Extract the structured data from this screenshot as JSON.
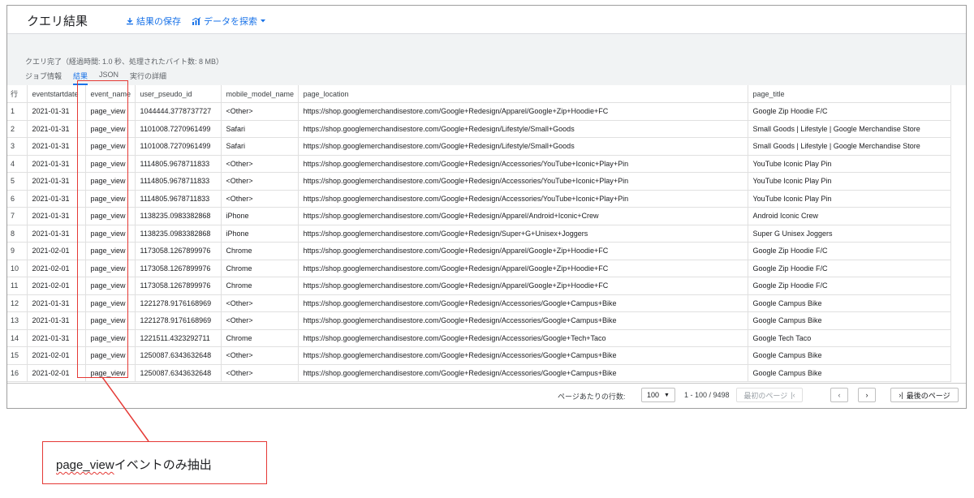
{
  "header": {
    "title": "クエリ結果",
    "save_label": "結果の保存",
    "explore_label": "データを探索"
  },
  "status_text": "クエリ完了（経過時間: 1.0 秒、処理されたバイト数: 8 MB）",
  "tabs": [
    {
      "label": "ジョブ情報",
      "active": false
    },
    {
      "label": "結果",
      "active": true
    },
    {
      "label": "JSON",
      "active": false
    },
    {
      "label": "実行の詳細",
      "active": false
    }
  ],
  "table": {
    "columns": [
      "行",
      "eventstartdate",
      "event_name",
      "user_pseudo_id",
      "mobile_model_name",
      "page_location",
      "page_title"
    ],
    "rows": [
      [
        "1",
        "2021-01-31",
        "page_view",
        "1044444.3778737727",
        "<Other>",
        "https://shop.googlemerchandisestore.com/Google+Redesign/Apparel/Google+Zip+Hoodie+FC",
        "Google Zip Hoodie F/C"
      ],
      [
        "2",
        "2021-01-31",
        "page_view",
        "1101008.7270961499",
        "Safari",
        "https://shop.googlemerchandisestore.com/Google+Redesign/Lifestyle/Small+Goods",
        "Small Goods | Lifestyle | Google Merchandise Store"
      ],
      [
        "3",
        "2021-01-31",
        "page_view",
        "1101008.7270961499",
        "Safari",
        "https://shop.googlemerchandisestore.com/Google+Redesign/Lifestyle/Small+Goods",
        "Small Goods | Lifestyle | Google Merchandise Store"
      ],
      [
        "4",
        "2021-01-31",
        "page_view",
        "1114805.9678711833",
        "<Other>",
        "https://shop.googlemerchandisestore.com/Google+Redesign/Accessories/YouTube+Iconic+Play+Pin",
        "YouTube Iconic Play Pin"
      ],
      [
        "5",
        "2021-01-31",
        "page_view",
        "1114805.9678711833",
        "<Other>",
        "https://shop.googlemerchandisestore.com/Google+Redesign/Accessories/YouTube+Iconic+Play+Pin",
        "YouTube Iconic Play Pin"
      ],
      [
        "6",
        "2021-01-31",
        "page_view",
        "1114805.9678711833",
        "<Other>",
        "https://shop.googlemerchandisestore.com/Google+Redesign/Accessories/YouTube+Iconic+Play+Pin",
        "YouTube Iconic Play Pin"
      ],
      [
        "7",
        "2021-01-31",
        "page_view",
        "1138235.0983382868",
        "iPhone",
        "https://shop.googlemerchandisestore.com/Google+Redesign/Apparel/Android+Iconic+Crew",
        "Android Iconic Crew"
      ],
      [
        "8",
        "2021-01-31",
        "page_view",
        "1138235.0983382868",
        "iPhone",
        "https://shop.googlemerchandisestore.com/Google+Redesign/Super+G+Unisex+Joggers",
        "Super G Unisex Joggers"
      ],
      [
        "9",
        "2021-02-01",
        "page_view",
        "1173058.1267899976",
        "Chrome",
        "https://shop.googlemerchandisestore.com/Google+Redesign/Apparel/Google+Zip+Hoodie+FC",
        "Google Zip Hoodie F/C"
      ],
      [
        "10",
        "2021-02-01",
        "page_view",
        "1173058.1267899976",
        "Chrome",
        "https://shop.googlemerchandisestore.com/Google+Redesign/Apparel/Google+Zip+Hoodie+FC",
        "Google Zip Hoodie F/C"
      ],
      [
        "11",
        "2021-02-01",
        "page_view",
        "1173058.1267899976",
        "Chrome",
        "https://shop.googlemerchandisestore.com/Google+Redesign/Apparel/Google+Zip+Hoodie+FC",
        "Google Zip Hoodie F/C"
      ],
      [
        "12",
        "2021-01-31",
        "page_view",
        "1221278.9176168969",
        "<Other>",
        "https://shop.googlemerchandisestore.com/Google+Redesign/Accessories/Google+Campus+Bike",
        "Google Campus Bike"
      ],
      [
        "13",
        "2021-01-31",
        "page_view",
        "1221278.9176168969",
        "<Other>",
        "https://shop.googlemerchandisestore.com/Google+Redesign/Accessories/Google+Campus+Bike",
        "Google Campus Bike"
      ],
      [
        "14",
        "2021-01-31",
        "page_view",
        "1221511.4323292711",
        "Chrome",
        "https://shop.googlemerchandisestore.com/Google+Redesign/Accessories/Google+Tech+Taco",
        "Google Tech Taco"
      ],
      [
        "15",
        "2021-02-01",
        "page_view",
        "1250087.6343632648",
        "<Other>",
        "https://shop.googlemerchandisestore.com/Google+Redesign/Accessories/Google+Campus+Bike",
        "Google Campus Bike"
      ],
      [
        "16",
        "2021-02-01",
        "page_view",
        "1250087.6343632648",
        "<Other>",
        "https://shop.googlemerchandisestore.com/Google+Redesign/Accessories/Google+Campus+Bike",
        "Google Campus Bike"
      ]
    ]
  },
  "footer": {
    "rows_per_page_label": "ページあたりの行数:",
    "rows_per_page_value": "100",
    "range_text": "1 - 100 / 9498",
    "first_page_label": "最初のページ",
    "last_page_label": "最後のページ"
  },
  "callout": {
    "underlined": "page_view",
    "rest": "イベントのみ抽出"
  },
  "colors": {
    "accent": "#1a73e8",
    "highlight": "#e53935"
  }
}
